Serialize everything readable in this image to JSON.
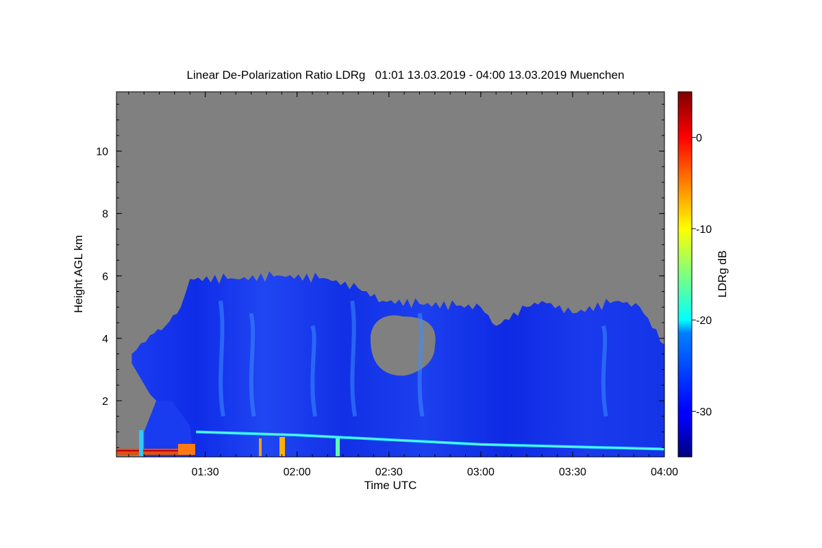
{
  "chart_data": {
    "type": "heatmap",
    "title": "Linear De-Polarization Ratio LDRg   01:01 13.03.2019 - 04:00 13.03.2019 Muenchen",
    "xlabel": "Time UTC",
    "ylabel": "Height AGL km",
    "xlim": [
      "01:01",
      "04:00"
    ],
    "ylim": [
      0.2,
      11.9
    ],
    "x_tick_labels": [
      "01:30",
      "02:00",
      "02:30",
      "03:00",
      "03:30",
      "04:00"
    ],
    "y_tick_labels": [
      "2",
      "4",
      "6",
      "8",
      "10"
    ],
    "colorbar": {
      "label": "LDRg dB",
      "range": [
        -35,
        5
      ],
      "tick_labels": [
        "0",
        "-10",
        "-20",
        "-30"
      ],
      "colormap": "jet"
    },
    "background_color": "#808080",
    "cloud_top_profile": [
      {
        "time": "01:06",
        "top_km": 3.5
      },
      {
        "time": "01:12",
        "top_km": 4.1
      },
      {
        "time": "01:17",
        "top_km": 4.4
      },
      {
        "time": "01:22",
        "top_km": 5.0
      },
      {
        "time": "01:25",
        "top_km": 5.9
      },
      {
        "time": "01:40",
        "top_km": 5.9
      },
      {
        "time": "01:55",
        "top_km": 6.0
      },
      {
        "time": "02:10",
        "top_km": 5.9
      },
      {
        "time": "02:20",
        "top_km": 5.6
      },
      {
        "time": "02:28",
        "top_km": 5.2
      },
      {
        "time": "02:40",
        "top_km": 5.1
      },
      {
        "time": "03:00",
        "top_km": 5.0
      },
      {
        "time": "03:05",
        "top_km": 4.4
      },
      {
        "time": "03:15",
        "top_km": 5.0
      },
      {
        "time": "03:20",
        "top_km": 5.2
      },
      {
        "time": "03:30",
        "top_km": 4.8
      },
      {
        "time": "03:45",
        "top_km": 5.2
      },
      {
        "time": "03:52",
        "top_km": 5.0
      },
      {
        "time": "04:00",
        "top_km": 3.8
      }
    ],
    "boundary_layer_top_km": [
      {
        "time": "01:27",
        "top_km": 1.0
      },
      {
        "time": "02:00",
        "top_km": 0.9
      },
      {
        "time": "03:00",
        "top_km": 0.6
      },
      {
        "time": "04:00",
        "top_km": 0.45
      }
    ],
    "clear_gap": {
      "time_range": [
        "02:24",
        "02:45"
      ],
      "height_range_km": [
        2.8,
        4.7
      ]
    }
  }
}
